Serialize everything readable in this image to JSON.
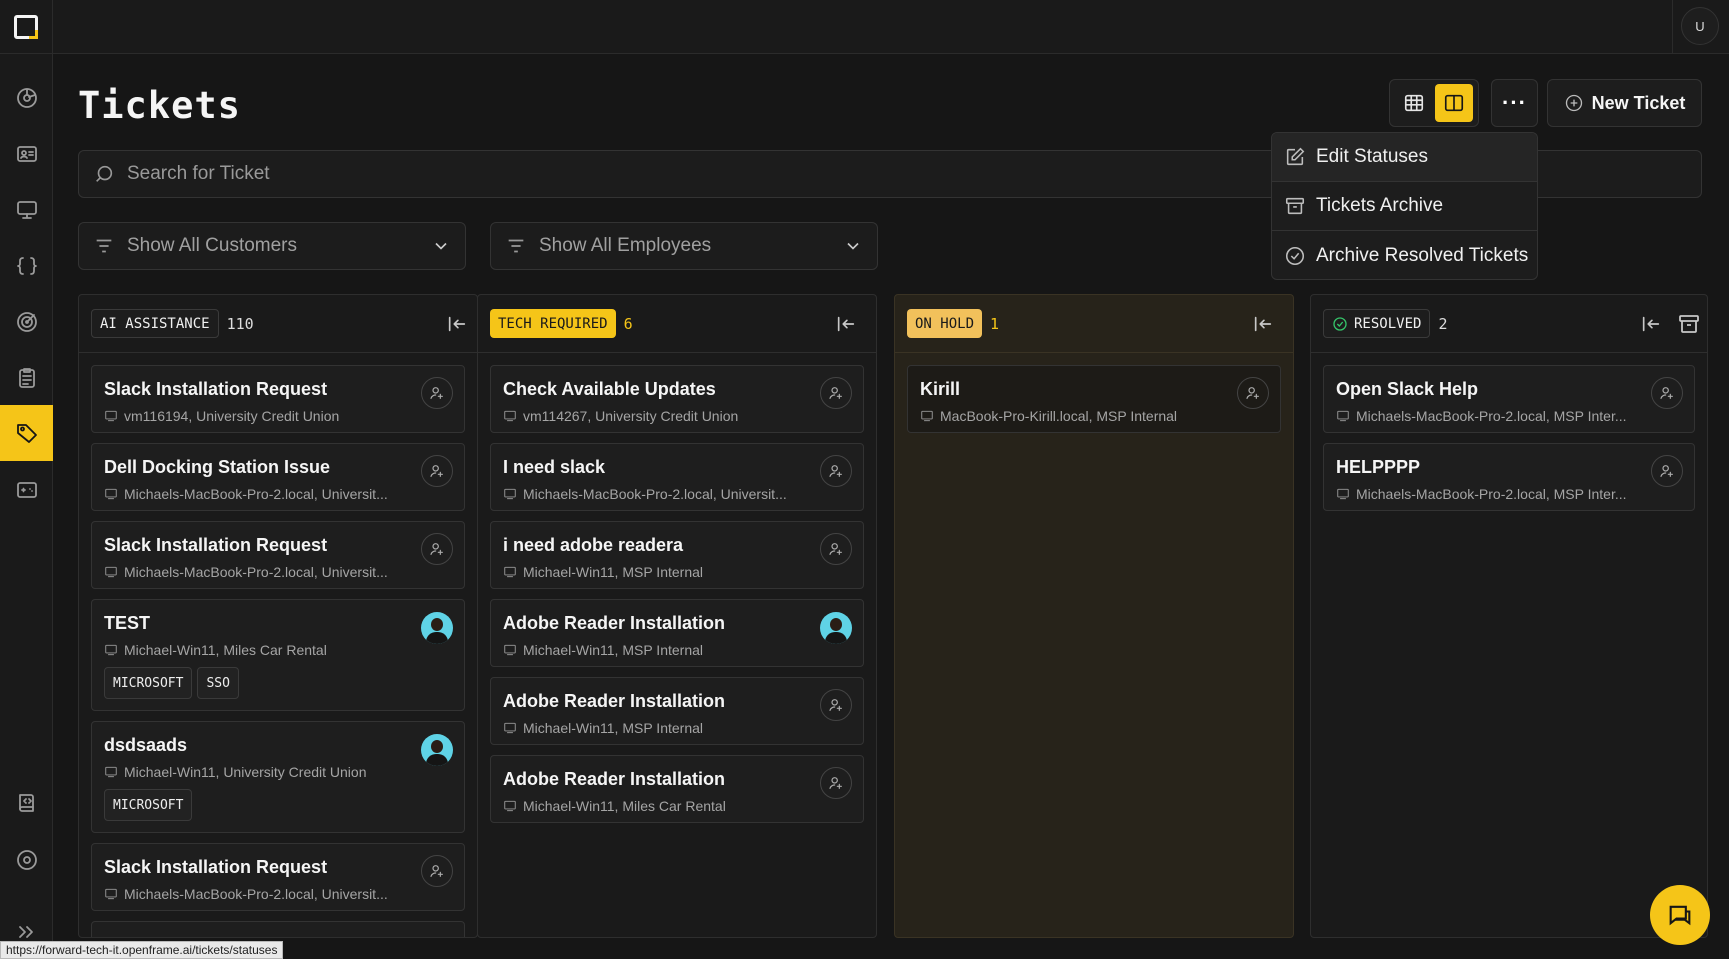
{
  "app": {
    "user_initial": "U"
  },
  "sidebar": {
    "items": [
      {
        "icon": "dashboard-icon"
      },
      {
        "icon": "contacts-icon"
      },
      {
        "icon": "devices-icon"
      },
      {
        "icon": "scripts-icon"
      },
      {
        "icon": "monitoring-icon"
      },
      {
        "icon": "logs-icon"
      },
      {
        "icon": "tickets-icon",
        "active": true
      },
      {
        "icon": "remote-icon"
      },
      {
        "icon": "knowledge-icon"
      },
      {
        "icon": "settings-icon"
      },
      {
        "icon": "expand-icon"
      }
    ]
  },
  "header": {
    "title": "Tickets",
    "new_ticket_label": "New Ticket",
    "more_label": "···"
  },
  "search": {
    "placeholder": "Search for Ticket"
  },
  "filters": {
    "customers": "Show All Customers",
    "employees": "Show All Employees"
  },
  "menu": {
    "items": [
      "Edit Statuses",
      "Tickets Archive",
      "Archive Resolved Tickets"
    ]
  },
  "columns": [
    {
      "label": "AI ASSISTANCE",
      "count": "110",
      "cards": [
        {
          "title": "Slack Installation Request",
          "sub": "vm116194, University Credit Union",
          "assigned": false,
          "tags": []
        },
        {
          "title": "Dell Docking Station Issue",
          "sub": "Michaels-MacBook-Pro-2.local, Universit...",
          "assigned": false,
          "tags": []
        },
        {
          "title": "Slack Installation Request",
          "sub": "Michaels-MacBook-Pro-2.local, Universit...",
          "assigned": false,
          "tags": []
        },
        {
          "title": "TEST",
          "sub": "Michael-Win11, Miles Car Rental",
          "assigned": true,
          "tags": [
            "MICROSOFT",
            "SSO"
          ]
        },
        {
          "title": "dsdsaads",
          "sub": "Michael-Win11, University Credit Union",
          "assigned": true,
          "tags": [
            "MICROSOFT"
          ]
        },
        {
          "title": "Slack Installation Request",
          "sub": "Michaels-MacBook-Pro-2.local, Universit...",
          "assigned": false,
          "tags": []
        }
      ]
    },
    {
      "label": "TECH REQUIRED",
      "count": "6",
      "cards": [
        {
          "title": "Check Available Updates",
          "sub": "vm114267, University Credit Union",
          "assigned": false
        },
        {
          "title": "I need slack",
          "sub": "Michaels-MacBook-Pro-2.local, Universit...",
          "assigned": false
        },
        {
          "title": "i need adobe readera",
          "sub": "Michael-Win11, MSP Internal",
          "assigned": false
        },
        {
          "title": "Adobe Reader Installation",
          "sub": "Michael-Win11, MSP Internal",
          "assigned": true
        },
        {
          "title": "Adobe Reader Installation",
          "sub": "Michael-Win11, MSP Internal",
          "assigned": false
        },
        {
          "title": "Adobe Reader Installation",
          "sub": "Michael-Win11, Miles Car Rental",
          "assigned": false
        }
      ]
    },
    {
      "label": "ON HOLD",
      "count": "1",
      "cards": [
        {
          "title": "Kirill",
          "sub": "MacBook-Pro-Kirill.local, MSP Internal",
          "assigned": false
        }
      ]
    },
    {
      "label": "RESOLVED",
      "count": "2",
      "cards": [
        {
          "title": "Open Slack Help",
          "sub": "Michaels-MacBook-Pro-2.local, MSP Inter...",
          "assigned": false
        },
        {
          "title": "HELPPPP",
          "sub": "Michaels-MacBook-Pro-2.local, MSP Inter...",
          "assigned": false
        }
      ]
    }
  ],
  "status_bar": {
    "url": "https://forward-tech-it.openframe.ai/tickets/statuses"
  },
  "colors": {
    "accent": "#f5c518",
    "background": "#161616",
    "on_hold_bg": "#27231a",
    "resolved_check": "#35c46a"
  }
}
